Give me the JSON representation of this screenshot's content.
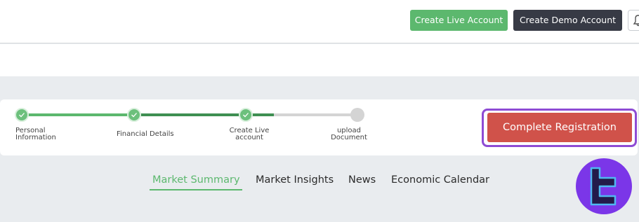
{
  "header": {
    "live_label": "Create Live Account",
    "demo_label": "Create Demo Account",
    "bell_icon": "bell-icon"
  },
  "colors": {
    "green": "#5cb86e",
    "dark": "#373a45",
    "register": "#d0524a",
    "highlight": "#8e4bd4"
  },
  "progress": {
    "steps": [
      {
        "line1": "Personal",
        "line2": "Information",
        "done": true
      },
      {
        "line1": "Financial Details",
        "line2": "",
        "done": true
      },
      {
        "line1": "Create Live",
        "line2": "account",
        "done": true
      },
      {
        "line1": "upload",
        "line2": "Document",
        "done": false
      }
    ],
    "completed": 3,
    "total": 4
  },
  "register_label": "Complete Registration",
  "tabs": [
    {
      "label": "Market Summary",
      "active": true
    },
    {
      "label": "Market Insights",
      "active": false
    },
    {
      "label": "News",
      "active": false
    },
    {
      "label": "Economic Calendar",
      "active": false
    }
  ]
}
